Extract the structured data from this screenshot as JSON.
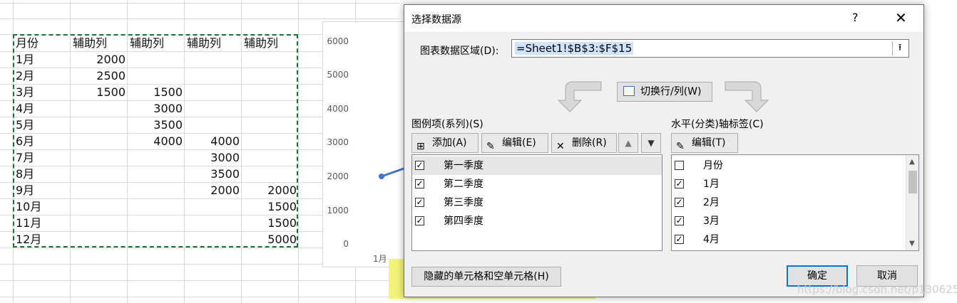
{
  "sheet": {
    "header": [
      "月份",
      "辅助列",
      "辅助列",
      "辅助列",
      "辅助列"
    ],
    "rows": [
      [
        "1月",
        "2000",
        "",
        "",
        ""
      ],
      [
        "2月",
        "2500",
        "",
        "",
        ""
      ],
      [
        "3月",
        "1500",
        "1500",
        "",
        ""
      ],
      [
        "4月",
        "",
        "3000",
        "",
        ""
      ],
      [
        "5月",
        "",
        "3500",
        "",
        ""
      ],
      [
        "6月",
        "",
        "4000",
        "4000",
        ""
      ],
      [
        "7月",
        "",
        "",
        "3000",
        ""
      ],
      [
        "8月",
        "",
        "",
        "3500",
        ""
      ],
      [
        "9月",
        "",
        "",
        "2000",
        "2000"
      ],
      [
        "10月",
        "",
        "",
        "",
        "1500"
      ],
      [
        "11月",
        "",
        "",
        "",
        "1500"
      ],
      [
        "12月",
        "",
        "",
        "",
        "5000"
      ]
    ]
  },
  "chart": {
    "y_ticks": [
      "6000",
      "5000",
      "4000",
      "3000",
      "2000",
      "1000",
      "0"
    ],
    "x_first_label": "1月",
    "series_color": "#4472c4",
    "first_point_value": 2000
  },
  "dialog": {
    "title": "选择数据源",
    "help": "?",
    "close": "✕",
    "range_label": "图表数据区域(D):",
    "range_value": "=Sheet1!$B$3:$F$15",
    "switch_label": "切换行/列(W)",
    "legend_title": "图例项(系列)(S)",
    "axis_title": "水平(分类)轴标签(C)",
    "add_label": "添加(A)",
    "edit_label": "编辑(E)",
    "delete_label": "删除(R)",
    "axis_edit_label": "编辑(T)",
    "series": [
      "第一季度",
      "第二季度",
      "第三季度",
      "第四季度"
    ],
    "categories": [
      {
        "label": "月份",
        "checked": false
      },
      {
        "label": "1月",
        "checked": true
      },
      {
        "label": "2月",
        "checked": true
      },
      {
        "label": "3月",
        "checked": true
      },
      {
        "label": "4月",
        "checked": true
      }
    ],
    "hidden_cells_label": "隐藏的单元格和空单元格(H)",
    "ok_label": "确定",
    "cancel_label": "取消",
    "accent": "#0078d7"
  },
  "watermark": "https://blog.csdn.net/p1306252"
}
